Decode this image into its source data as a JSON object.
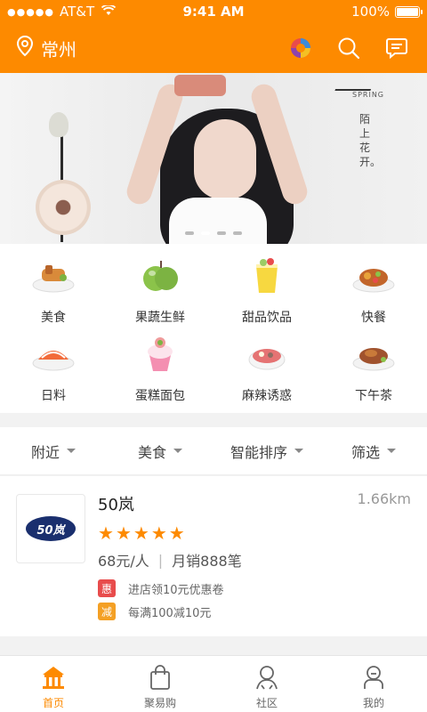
{
  "status_bar": {
    "dots": "●●●●●",
    "carrier": "AT&T",
    "time": "9:41 AM",
    "battery": "100%"
  },
  "header": {
    "city": "常州",
    "accent_color": "#fd8a00"
  },
  "banner": {
    "spring": "SPRING",
    "poem": "陌上花开。",
    "page_count": 4,
    "active_page": 1
  },
  "categories": [
    {
      "label": "美食",
      "icon": "food-icon"
    },
    {
      "label": "果蔬生鲜",
      "icon": "apple-icon"
    },
    {
      "label": "甜品饮品",
      "icon": "dessert-drink-icon"
    },
    {
      "label": "快餐",
      "icon": "fast-food-icon"
    },
    {
      "label": "日料",
      "icon": "sushi-icon"
    },
    {
      "label": "蛋糕面包",
      "icon": "cupcake-icon"
    },
    {
      "label": "麻辣诱惑",
      "icon": "spicy-food-icon"
    },
    {
      "label": "下午茶",
      "icon": "afternoon-tea-icon"
    }
  ],
  "filters": [
    {
      "label": "附近"
    },
    {
      "label": "美食"
    },
    {
      "label": "智能排序"
    },
    {
      "label": "筛选"
    }
  ],
  "shop": {
    "logo_text": "50岚",
    "name": "50岚",
    "distance": "1.66km",
    "rating": 5,
    "price": "68元/人",
    "monthly_sales": "月销888笔",
    "promos": [
      {
        "tag": "惠",
        "text": "进店领10元优惠卷"
      },
      {
        "tag": "减",
        "text": "每满100减10元"
      }
    ]
  },
  "tabs": [
    {
      "label": "首页",
      "icon": "home-icon",
      "active": true
    },
    {
      "label": "聚易购",
      "icon": "shopping-bag-icon",
      "active": false
    },
    {
      "label": "社区",
      "icon": "community-icon",
      "active": false
    },
    {
      "label": "我的",
      "icon": "profile-icon",
      "active": false
    }
  ]
}
